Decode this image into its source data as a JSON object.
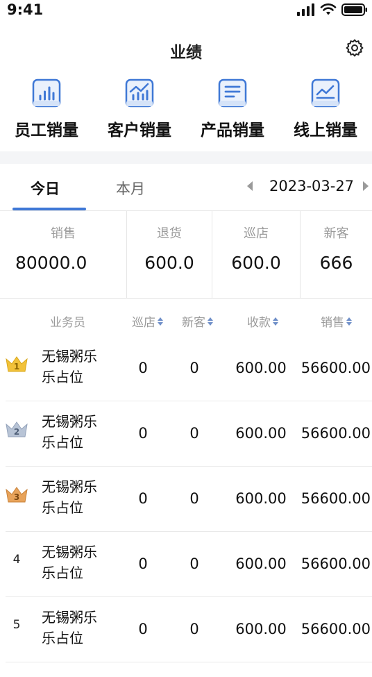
{
  "status_bar": {
    "time": "9:41"
  },
  "nav": {
    "title": "业绩"
  },
  "shortcuts": [
    {
      "label": "员工销量",
      "icon": "bar-chart-icon"
    },
    {
      "label": "客户销量",
      "icon": "trend-chart-icon"
    },
    {
      "label": "产品销量",
      "icon": "document-list-icon"
    },
    {
      "label": "线上销量",
      "icon": "line-chart-icon"
    }
  ],
  "tabs": {
    "today": "今日",
    "month": "本月",
    "active": "today"
  },
  "date": {
    "value": "2023-03-27"
  },
  "stats": [
    {
      "label": "销售",
      "value": "80000.0"
    },
    {
      "label": "退货",
      "value": "600.0"
    },
    {
      "label": "巡店",
      "value": "600.0"
    },
    {
      "label": "新客",
      "value": "666"
    }
  ],
  "table": {
    "headers": {
      "salesperson": "业务员",
      "store_visits": "巡店",
      "new_customers": "新客",
      "payment": "收款",
      "sales": "销售"
    },
    "rows": [
      {
        "rank": "1",
        "name_line1": "无锡粥乐",
        "name_line2": "乐占位",
        "store_visits": "0",
        "new_customers": "0",
        "payment": "600.00",
        "sales": "56600.00"
      },
      {
        "rank": "2",
        "name_line1": "无锡粥乐",
        "name_line2": "乐占位",
        "store_visits": "0",
        "new_customers": "0",
        "payment": "600.00",
        "sales": "56600.00"
      },
      {
        "rank": "3",
        "name_line1": "无锡粥乐",
        "name_line2": "乐占位",
        "store_visits": "0",
        "new_customers": "0",
        "payment": "600.00",
        "sales": "56600.00"
      },
      {
        "rank": "4",
        "name_line1": "无锡粥乐",
        "name_line2": "乐占位",
        "store_visits": "0",
        "new_customers": "0",
        "payment": "600.00",
        "sales": "56600.00"
      },
      {
        "rank": "5",
        "name_line1": "无锡粥乐",
        "name_line2": "乐占位",
        "store_visits": "0",
        "new_customers": "0",
        "payment": "600.00",
        "sales": "56600.00"
      }
    ]
  },
  "colors": {
    "accent": "#3f78d6",
    "gold": "#f2c23a",
    "silver": "#b8c4d6",
    "bronze": "#e8a35a"
  }
}
